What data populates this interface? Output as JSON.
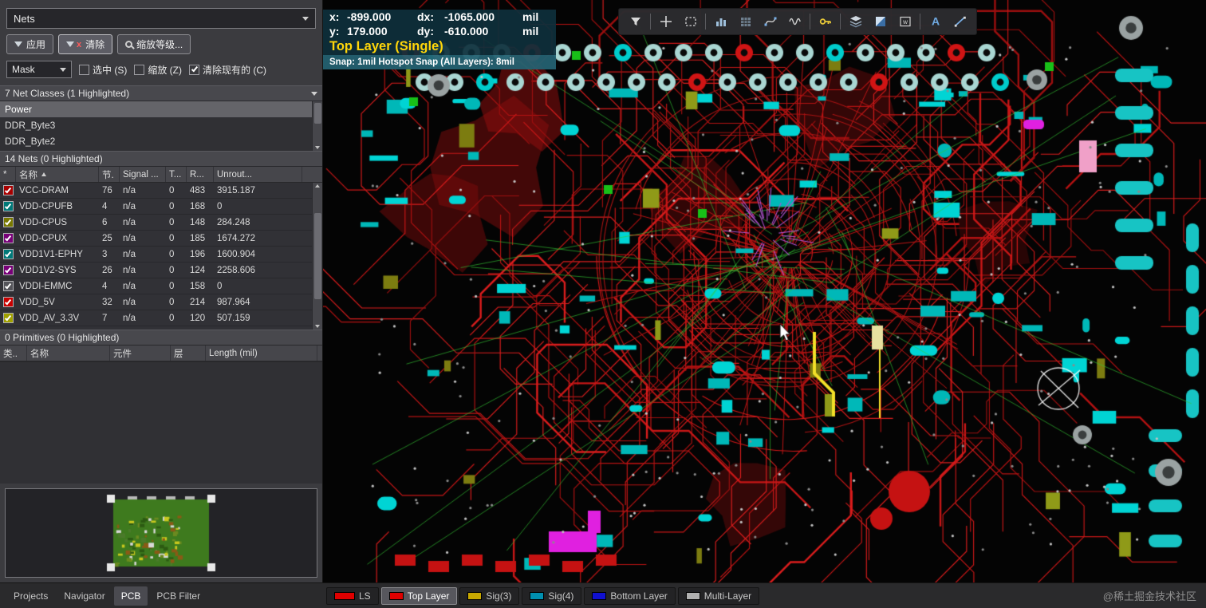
{
  "panel": {
    "selector": {
      "value": "Nets"
    },
    "toolbar": {
      "apply": "应用",
      "clear": "清除",
      "zoom_level": "缩放等级..."
    },
    "mask": {
      "label": "Mask",
      "checkboxes": [
        {
          "label": "选中 (S)",
          "checked": false
        },
        {
          "label": "缩放 (Z)",
          "checked": false
        },
        {
          "label": "清除现有的 (C)",
          "checked": true
        }
      ]
    },
    "net_classes": {
      "header": "7 Net Classes (1 Highlighted)",
      "items": [
        {
          "label": "Power",
          "selected": true
        },
        {
          "label": "DDR_Byte3",
          "selected": false
        },
        {
          "label": "DDR_Byte2",
          "selected": false
        }
      ]
    },
    "nets": {
      "header": "14 Nets (0 Highlighted)",
      "columns": {
        "star": "*",
        "name": "名称",
        "nodes": "节.",
        "signal": "Signal ...",
        "t": "T...",
        "r": "R...",
        "unrouted": "Unrout..."
      },
      "rows": [
        {
          "color": "#a80000",
          "name": "VCC-DRAM",
          "nodes": "76",
          "signal": "n/a",
          "t": "0",
          "r": "483",
          "unrouted": "3915.187"
        },
        {
          "color": "#007878",
          "name": "VDD-CPUFB",
          "nodes": "4",
          "signal": "n/a",
          "t": "0",
          "r": "168",
          "unrouted": "0"
        },
        {
          "color": "#787800",
          "name": "VDD-CPUS",
          "nodes": "6",
          "signal": "n/a",
          "t": "0",
          "r": "148",
          "unrouted": "284.248"
        },
        {
          "color": "#780078",
          "name": "VDD-CPUX",
          "nodes": "25",
          "signal": "n/a",
          "t": "0",
          "r": "185",
          "unrouted": "1674.272"
        },
        {
          "color": "#007878",
          "name": "VDD1V1-EPHY",
          "nodes": "3",
          "signal": "n/a",
          "t": "0",
          "r": "196",
          "unrouted": "1600.904"
        },
        {
          "color": "#780078",
          "name": "VDD1V2-SYS",
          "nodes": "26",
          "signal": "n/a",
          "t": "0",
          "r": "124",
          "unrouted": "2258.606"
        },
        {
          "color": "#54545a",
          "name": "VDDI-EMMC",
          "nodes": "4",
          "signal": "n/a",
          "t": "0",
          "r": "158",
          "unrouted": "0"
        },
        {
          "color": "#c80000",
          "name": "VDD_5V",
          "nodes": "32",
          "signal": "n/a",
          "t": "0",
          "r": "214",
          "unrouted": "987.964"
        },
        {
          "color": "#a0a000",
          "name": "VDD_AV_3.3V",
          "nodes": "7",
          "signal": "n/a",
          "t": "0",
          "r": "120",
          "unrouted": "507.159"
        }
      ]
    },
    "primitives": {
      "header": "0 Primitives (0 Highlighted)",
      "columns": {
        "type": "类..",
        "name": "名称",
        "component": "元件",
        "layer": "层",
        "length": "Length (mil)"
      }
    },
    "tabs": [
      {
        "label": "Projects",
        "active": false
      },
      {
        "label": "Navigator",
        "active": false
      },
      {
        "label": "PCB",
        "active": true
      },
      {
        "label": "PCB Filter",
        "active": false
      }
    ]
  },
  "hud": {
    "x_label": "x:",
    "x_value": "-899.000",
    "dx_label": "dx:",
    "dx_value": "-1065.000",
    "y_label": "y:",
    "y_value": "179.000",
    "dy_label": "dy:",
    "dy_value": "-610.000",
    "unit": "mil",
    "layer_status": "Top Layer (Single)",
    "snap_status": "Snap: 1mil Hotspot Snap (All Layers): 8mil"
  },
  "view_toolbar": {
    "icons": [
      {
        "name": "filter-icon"
      },
      {
        "name": "crosshair-icon"
      },
      {
        "name": "marquee-select-icon"
      },
      {
        "name": "histogram-icon"
      },
      {
        "name": "grid-pattern-icon"
      },
      {
        "name": "bezier-curve-icon"
      },
      {
        "name": "waveform-icon"
      },
      {
        "name": "key-icon"
      },
      {
        "name": "layer-stack-icon"
      },
      {
        "name": "contrast-square-icon"
      },
      {
        "name": "polygon-w-icon"
      },
      {
        "name": "text-tool-icon"
      },
      {
        "name": "line-tool-icon"
      }
    ]
  },
  "layer_bar": {
    "tabs": [
      {
        "label": "LS",
        "color": "#e00000",
        "active": false,
        "wide": true
      },
      {
        "label": "Top Layer",
        "color": "#e00000",
        "active": true,
        "wide": false
      },
      {
        "label": "Sig(3)",
        "color": "#c8a800",
        "active": false,
        "wide": false
      },
      {
        "label": "Sig(4)",
        "color": "#0090b0",
        "active": false,
        "wide": false
      },
      {
        "label": "Bottom Layer",
        "color": "#1010d0",
        "active": false,
        "wide": false
      },
      {
        "label": "Multi-Layer",
        "color": "#b0b0b0",
        "active": false,
        "wide": false
      }
    ]
  },
  "watermark": "@稀土掘金技术社区"
}
